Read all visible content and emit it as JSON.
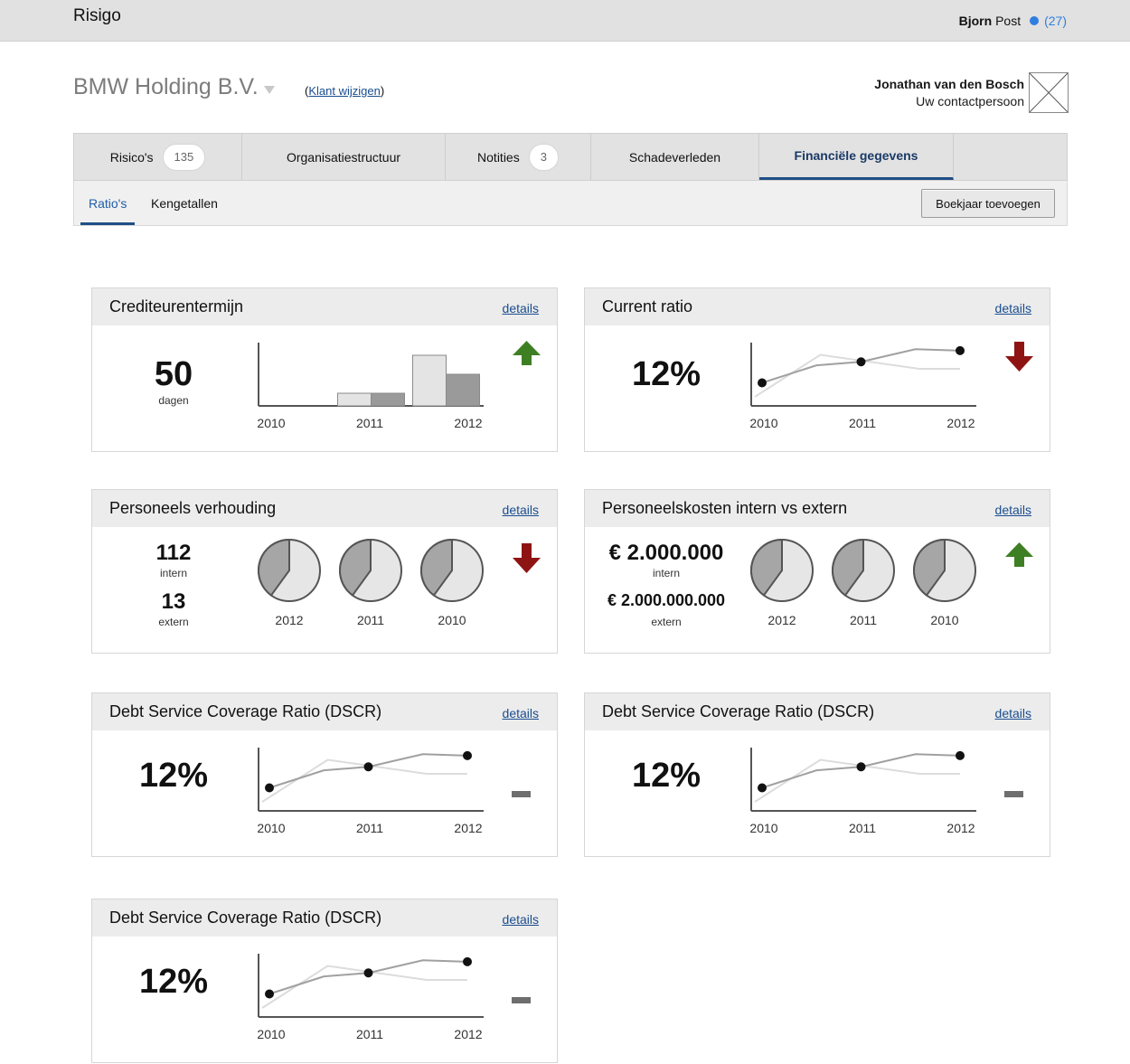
{
  "app": {
    "title": "Risigo"
  },
  "user": {
    "first_name": "Bjorn",
    "last_name": "Post",
    "notifications": "(27)"
  },
  "client": {
    "name": "BMW Holding B.V.",
    "change_open": "(",
    "change_link": "Klant wijzigen",
    "change_close": ")"
  },
  "contact": {
    "name": "Jonathan van den Bosch",
    "role": "Uw contactpersoon"
  },
  "tabs": [
    {
      "label": "Risico's",
      "badge": "135"
    },
    {
      "label": "Organisatiestructuur"
    },
    {
      "label": "Notities",
      "badge": "3"
    },
    {
      "label": "Schadeverleden"
    },
    {
      "label": "Financiële gegevens",
      "active": true
    }
  ],
  "subtabs": [
    {
      "label": "Ratio's",
      "active": true
    },
    {
      "label": "Kengetallen"
    }
  ],
  "add_year_button": "Boekjaar toevoegen",
  "details_label": "details",
  "cards": [
    {
      "title": "Crediteurentermijn",
      "value": "50",
      "unit": "dagen",
      "trend": "up"
    },
    {
      "title": "Current ratio",
      "value": "12%",
      "trend": "down"
    },
    {
      "title": "Personeels verhouding",
      "value_1": "112",
      "unit_1": "intern",
      "value_2": "13",
      "unit_2": "extern",
      "trend": "down"
    },
    {
      "title": "Personeelskosten intern vs extern",
      "value_1": "€ 2.000.000",
      "unit_1": "intern",
      "value_2": "€ 2.000.000.000",
      "unit_2": "extern",
      "trend": "up"
    },
    {
      "title": "Debt Service Coverage Ratio (DSCR)",
      "value": "12%",
      "trend": "neutral"
    },
    {
      "title": "Debt Service Coverage Ratio (DSCR)",
      "value": "12%",
      "trend": "neutral"
    },
    {
      "title": "Debt Service Coverage Ratio (DSCR)",
      "value": "12%",
      "trend": "neutral"
    }
  ],
  "colors": {
    "up": "#3f7f24",
    "down": "#8e1414",
    "neutral": "#6e6e6e",
    "accent": "#1f4f86",
    "link": "#1a4d8f",
    "notification": "#2f7ee0"
  },
  "chart_data": [
    {
      "type": "bar",
      "categories": [
        "2010",
        "2011",
        "2012"
      ],
      "series": [
        {
          "values": [
            0,
            1,
            4
          ]
        },
        {
          "values": [
            0,
            1,
            2.5
          ]
        }
      ],
      "ylim": [
        0,
        5
      ],
      "grid": false
    },
    {
      "type": "line",
      "x": [
        "2010",
        "2011",
        "2012"
      ],
      "series": [
        {
          "values": [
            1,
            2.5,
            3.3
          ]
        },
        {
          "values": [
            0,
            3,
            2
          ]
        }
      ],
      "ylim": [
        0,
        4
      ],
      "grid": false
    },
    {
      "type": "pie",
      "categories": [
        "2012",
        "2011",
        "2010"
      ],
      "slices": [
        {
          "label": "2012",
          "values": [
            40,
            60
          ]
        },
        {
          "label": "2011",
          "values": [
            40,
            60
          ]
        },
        {
          "label": "2010",
          "values": [
            40,
            60
          ]
        }
      ]
    },
    {
      "type": "pie",
      "categories": [
        "2012",
        "2011",
        "2010"
      ],
      "slices": [
        {
          "label": "2012",
          "values": [
            40,
            60
          ]
        },
        {
          "label": "2011",
          "values": [
            40,
            60
          ]
        },
        {
          "label": "2010",
          "values": [
            40,
            60
          ]
        }
      ]
    },
    {
      "type": "line",
      "x": [
        "2010",
        "2011",
        "2012"
      ],
      "series": [
        {
          "values": [
            1,
            2.5,
            3.3
          ]
        },
        {
          "values": [
            0,
            3,
            2
          ]
        }
      ],
      "ylim": [
        0,
        4
      ],
      "grid": false
    },
    {
      "type": "line",
      "x": [
        "2010",
        "2011",
        "2012"
      ],
      "series": [
        {
          "values": [
            1,
            2.5,
            3.3
          ]
        },
        {
          "values": [
            0,
            3,
            2
          ]
        }
      ],
      "ylim": [
        0,
        4
      ],
      "grid": false
    },
    {
      "type": "line",
      "x": [
        "2010",
        "2011",
        "2012"
      ],
      "series": [
        {
          "values": [
            1,
            2.5,
            3.3
          ]
        },
        {
          "values": [
            0,
            3,
            2
          ]
        }
      ],
      "ylim": [
        0,
        4
      ],
      "grid": false
    }
  ]
}
